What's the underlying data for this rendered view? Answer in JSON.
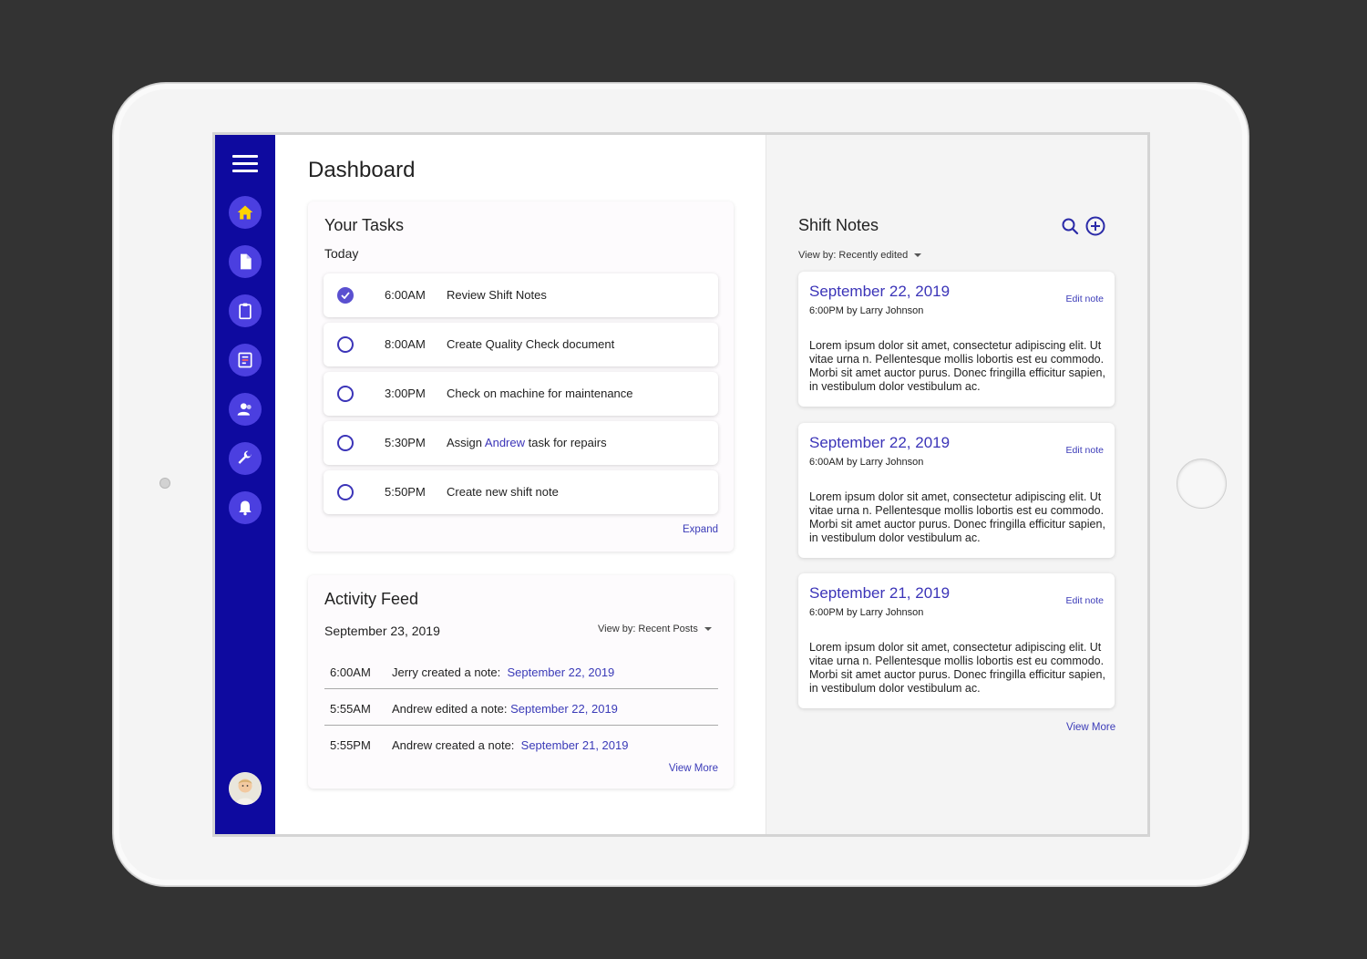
{
  "page": {
    "title": "Dashboard"
  },
  "sidebar": {
    "menu_icon": "hamburger-icon",
    "items": [
      {
        "icon": "home-icon",
        "active_color": "#ffd400"
      },
      {
        "icon": "document-icon"
      },
      {
        "icon": "clipboard-icon"
      },
      {
        "icon": "report-icon"
      },
      {
        "icon": "users-icon"
      },
      {
        "icon": "wrench-icon"
      },
      {
        "icon": "bell-icon"
      }
    ],
    "avatar": "user-avatar"
  },
  "tasks": {
    "title": "Your Tasks",
    "subtitle": "Today",
    "items": [
      {
        "time": "6:00AM",
        "label": "Review Shift Notes",
        "done": true
      },
      {
        "time": "8:00AM",
        "label": "Create Quality Check document",
        "done": false
      },
      {
        "time": "3:00PM",
        "label": "Check on machine for maintenance",
        "done": false
      },
      {
        "time": "5:30PM",
        "label_pre": "Assign ",
        "label_link": "Andrew",
        "label_post": " task for repairs",
        "done": false
      },
      {
        "time": "5:50PM",
        "label": "Create new shift note",
        "done": false
      }
    ],
    "expand_label": "Expand"
  },
  "feed": {
    "title": "Activity Feed",
    "date": "September 23, 2019",
    "view_by": "View by: Recent Posts",
    "rows": [
      {
        "time": "6:00AM",
        "text": "Jerry created a note:",
        "link": "September 22, 2019"
      },
      {
        "time": "5:55AM",
        "text": "Andrew edited a note:",
        "link": "September 22, 2019"
      },
      {
        "time": "5:55PM",
        "text": "Andrew created a note:",
        "link": "September 21, 2019"
      }
    ],
    "view_more": "View More"
  },
  "notes": {
    "title": "Shift Notes",
    "view_by": "View by: Recently edited",
    "edit_label": "Edit note",
    "cards": [
      {
        "date": "September 22, 2019",
        "time": "6:00PM",
        "by": "by",
        "author": "Larry Johnson",
        "body": "Lorem ipsum dolor sit amet, consectetur adipiscing elit. Ut vitae urna n. Pellentesque mollis lobortis est eu commodo. Morbi sit amet auctor purus. Donec fringilla efficitur sapien, in vestibulum dolor vestibulum ac."
      },
      {
        "date": "September 22, 2019",
        "time": "6:00AM",
        "by": "by",
        "author": "Larry Johnson",
        "body": "Lorem ipsum dolor sit amet, consectetur adipiscing elit. Ut vitae urna n. Pellentesque mollis lobortis est eu commodo. Morbi sit amet auctor purus. Donec fringilla efficitur sapien, in vestibulum dolor vestibulum ac."
      },
      {
        "date": "September 21, 2019",
        "time": "6:00PM",
        "by": "by",
        "author": "Larry Johnson",
        "body": "Lorem ipsum dolor sit amet, consectetur adipiscing elit. Ut vitae urna n. Pellentesque mollis lobortis est eu commodo. Morbi sit amet auctor purus. Donec fringilla efficitur sapien, in vestibulum dolor vestibulum ac."
      }
    ],
    "view_more": "View More"
  },
  "colors": {
    "sidebar": "#0e0a9f",
    "accent": "#3b34b8",
    "nav_button": "#4b3fe0"
  }
}
